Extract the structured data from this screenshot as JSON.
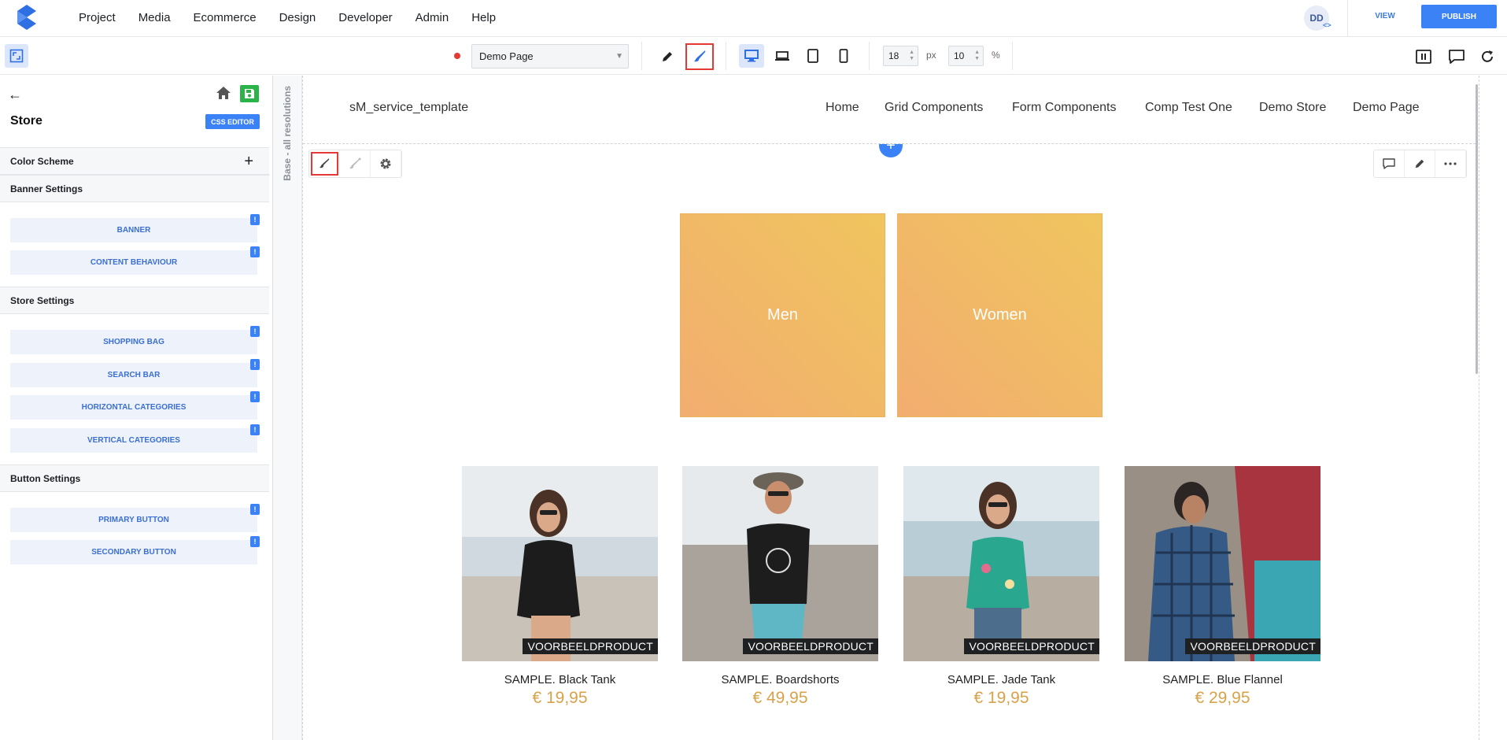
{
  "topnav": {
    "items": [
      "Project",
      "Media",
      "Ecommerce",
      "Design",
      "Developer",
      "Admin",
      "Help"
    ],
    "avatar": "DD",
    "avatar_code": "<>",
    "view": "VIEW",
    "publish": "PUBLISH"
  },
  "toolbar": {
    "page": "Demo Page",
    "size_value": "18",
    "size_unit": "px",
    "percent_value": "10",
    "percent_unit": "%"
  },
  "sidebar": {
    "title": "Store",
    "css_editor": "CSS EDITOR",
    "sections": {
      "color_scheme": "Color Scheme",
      "banner": "Banner Settings",
      "store": "Store Settings",
      "button": "Button Settings"
    },
    "banner_items": [
      "BANNER",
      "CONTENT BEHAVIOUR"
    ],
    "store_items": [
      "SHOPPING BAG",
      "SEARCH BAR",
      "HORIZONTAL CATEGORIES",
      "VERTICAL CATEGORIES"
    ],
    "button_items": [
      "PRIMARY BUTTON",
      "SECONDARY BUTTON"
    ],
    "badge": "!"
  },
  "canvas": {
    "vertical_label": "Base - all resolutions",
    "site_name": "sM_service_template",
    "site_nav": [
      "Home",
      "Grid Components",
      "Form Components",
      "Comp Test One",
      "Demo Store",
      "Demo Page"
    ],
    "categories": [
      "Men",
      "Women"
    ],
    "products": [
      {
        "badge": "VOORBEELDPRODUCT",
        "name": "SAMPLE. Black Tank",
        "price": "€ 19,95"
      },
      {
        "badge": "VOORBEELDPRODUCT",
        "name": "SAMPLE. Boardshorts",
        "price": "€ 49,95"
      },
      {
        "badge": "VOORBEELDPRODUCT",
        "name": "SAMPLE. Jade Tank",
        "price": "€ 19,95"
      },
      {
        "badge": "VOORBEELDPRODUCT",
        "name": "SAMPLE. Blue Flannel",
        "price": "€ 29,95"
      }
    ]
  },
  "colors": {
    "accent": "#3b82f6",
    "highlight": "#e53935",
    "price": "#d8a24a",
    "save": "#2bb34a"
  }
}
